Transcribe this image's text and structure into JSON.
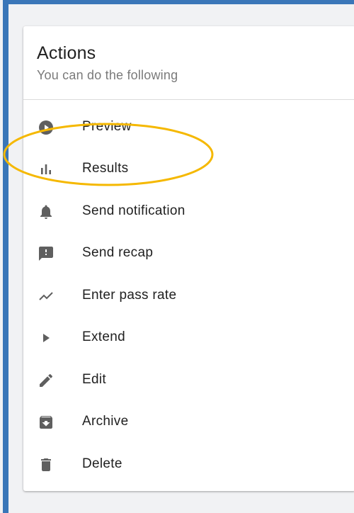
{
  "card": {
    "title": "Actions",
    "subtitle": "You can do the following"
  },
  "menu": {
    "items": [
      {
        "label": "Preview",
        "icon": "play-circle-icon"
      },
      {
        "label": "Results",
        "icon": "bar-chart-icon"
      },
      {
        "label": "Send notification",
        "icon": "bell-icon"
      },
      {
        "label": "Send recap",
        "icon": "feedback-icon"
      },
      {
        "label": "Enter pass rate",
        "icon": "trending-icon"
      },
      {
        "label": "Extend",
        "icon": "play-arrow-icon"
      },
      {
        "label": "Edit",
        "icon": "pencil-icon"
      },
      {
        "label": "Archive",
        "icon": "archive-icon"
      },
      {
        "label": "Delete",
        "icon": "trash-icon"
      }
    ]
  },
  "colors": {
    "frame_border": "#3a76b8",
    "highlight": "#f5b800",
    "icon": "#5f5f5f"
  }
}
